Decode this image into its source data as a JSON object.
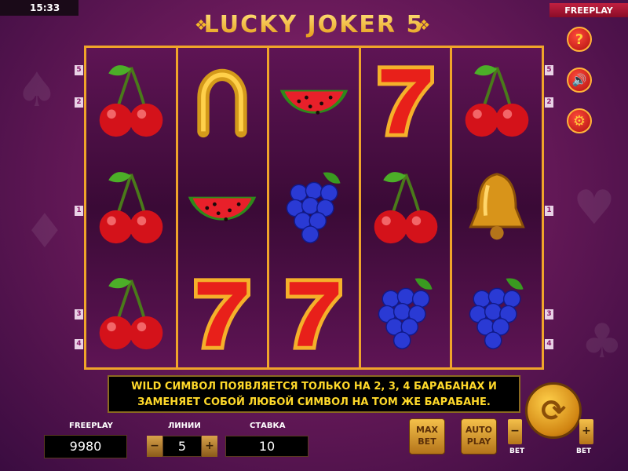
{
  "status": {
    "clock": "15:33",
    "mode": "FREEPLAY"
  },
  "title": "LUCKY JOKER 5",
  "side_buttons": [
    {
      "name": "help",
      "glyph": "?"
    },
    {
      "name": "sound",
      "glyph": "🔊"
    },
    {
      "name": "settings",
      "glyph": "⚙"
    }
  ],
  "reels": [
    [
      "cherry",
      "cherry",
      "cherry"
    ],
    [
      "horseshoe",
      "watermelon",
      "seven"
    ],
    [
      "watermelon",
      "grapes",
      "seven"
    ],
    [
      "seven",
      "cherry",
      "grapes"
    ],
    [
      "cherry",
      "bell",
      "grapes"
    ]
  ],
  "line_markers_left": [
    "5",
    "2",
    "1",
    "3",
    "4"
  ],
  "line_markers_right": [
    "5",
    "2",
    "1",
    "3",
    "4"
  ],
  "info": {
    "line1": "WILD СИМВОЛ ПОЯВЛЯЕТСЯ ТОЛЬКО НА 2, 3, 4 БАРАБАНАХ И",
    "line2": "ЗАМЕНЯЕТ СОБОЙ ЛЮБОЙ СИМВОЛ НА ТОМ ЖЕ БАРАБАНЕ."
  },
  "panel": {
    "balance_label": "FREEPLAY",
    "balance_value": "9980",
    "lines_label": "ЛИНИИ",
    "lines_value": "5",
    "bet_label": "СТАВКА",
    "bet_value": "10",
    "minus": "−",
    "plus": "+",
    "max_bet_line1": "MAX",
    "max_bet_line2": "BET",
    "auto_play_line1": "AUTO",
    "auto_play_line2": "PLAY",
    "bet_minus": "−",
    "bet_plus": "+",
    "bet_small_label": "BET"
  }
}
